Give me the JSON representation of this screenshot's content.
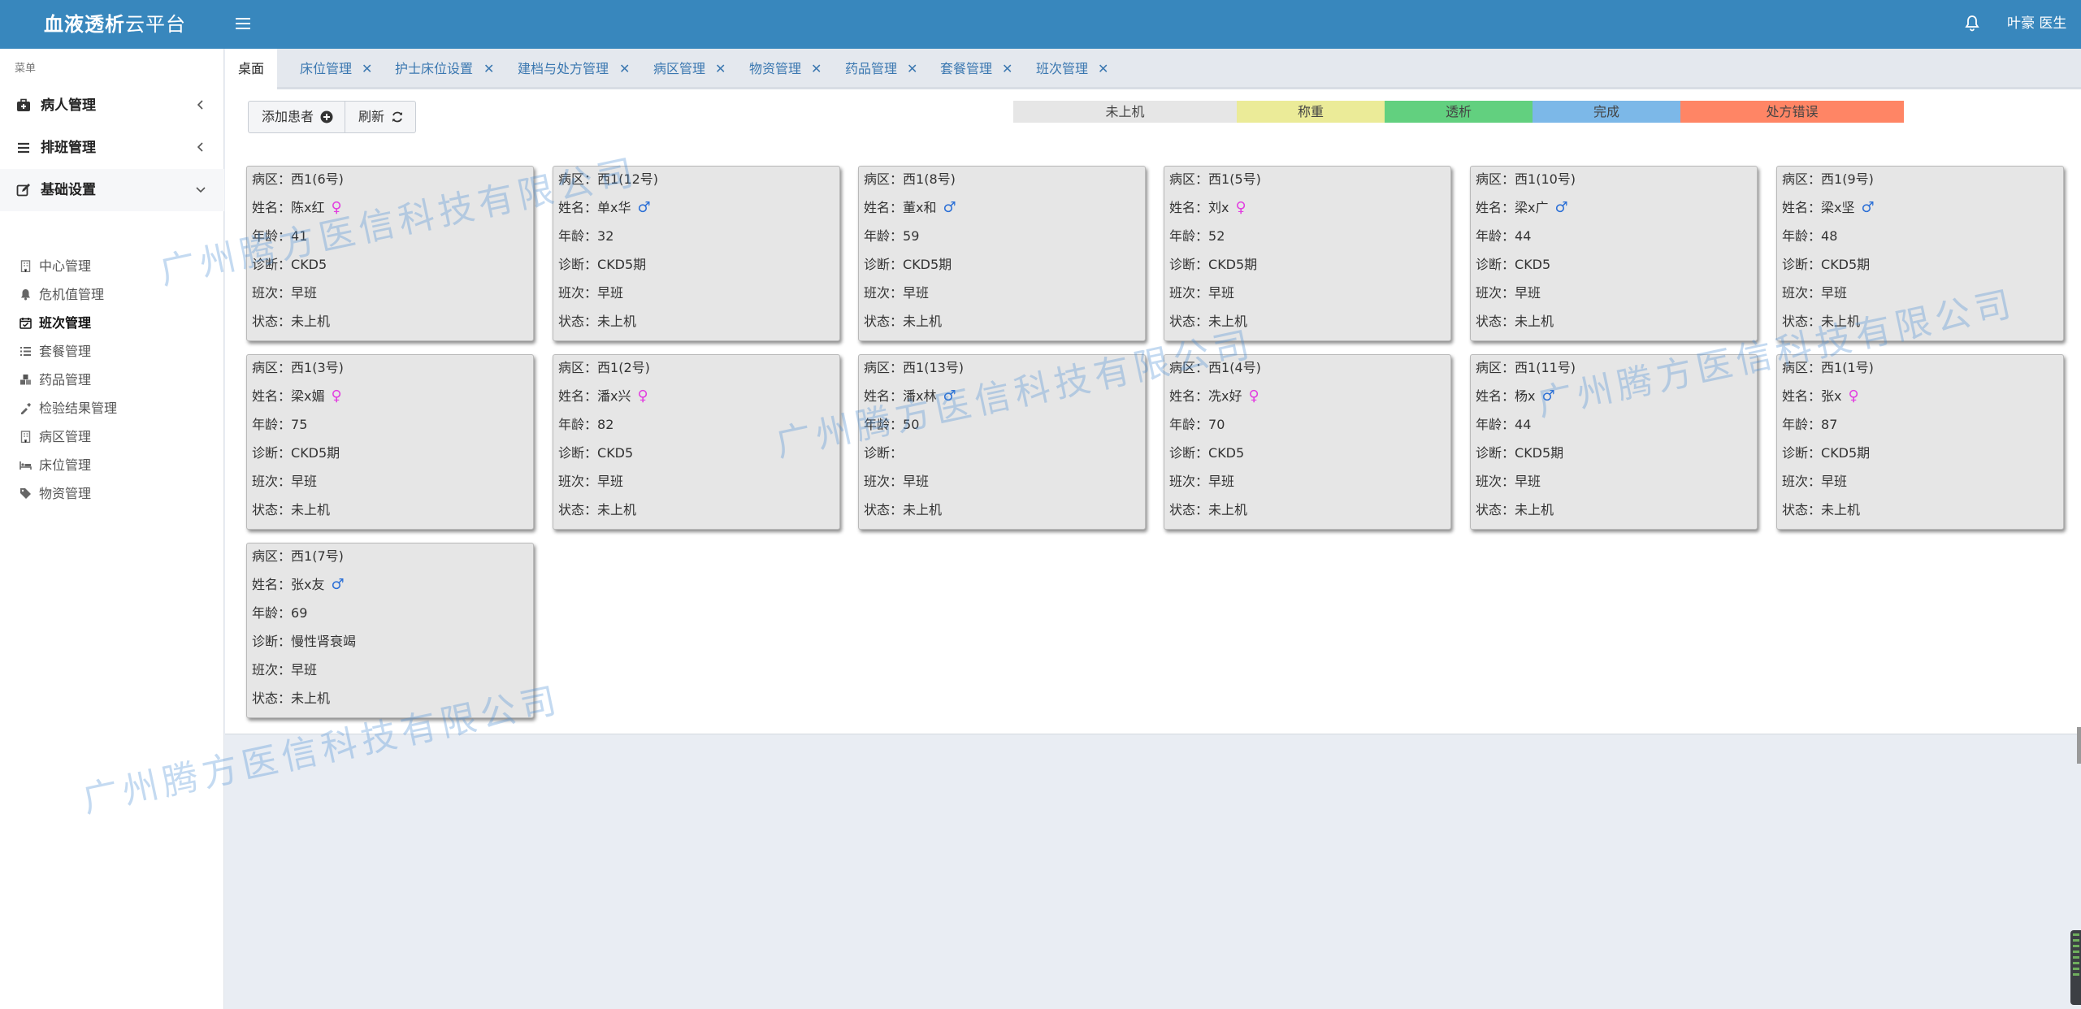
{
  "header": {
    "brand_bold": "血液透析",
    "brand_rest": "云平台",
    "user": "叶豪 医生"
  },
  "sidebar": {
    "caption": "菜单",
    "groups": [
      {
        "label": "病人管理",
        "icon": "medkit-icon",
        "expanded": false
      },
      {
        "label": "排班管理",
        "icon": "list-icon",
        "expanded": false
      },
      {
        "label": "基础设置",
        "icon": "edit-icon",
        "expanded": true
      }
    ],
    "items": [
      {
        "label": "中心管理",
        "icon": "building-icon"
      },
      {
        "label": "危机值管理",
        "icon": "bell-icon"
      },
      {
        "label": "班次管理",
        "icon": "calendar-check-icon"
      },
      {
        "label": "套餐管理",
        "icon": "list-icon"
      },
      {
        "label": "药品管理",
        "icon": "cubes-icon"
      },
      {
        "label": "检验结果管理",
        "icon": "eyedropper-icon"
      },
      {
        "label": "病区管理",
        "icon": "building-icon"
      },
      {
        "label": "床位管理",
        "icon": "bed-icon"
      },
      {
        "label": "物资管理",
        "icon": "tags-icon"
      }
    ],
    "current_item": "班次管理"
  },
  "tabs": [
    {
      "label": "桌面"
    },
    {
      "label": "床位管理"
    },
    {
      "label": "护士床位设置"
    },
    {
      "label": "建档与处方管理"
    },
    {
      "label": "病区管理"
    },
    {
      "label": "物资管理"
    },
    {
      "label": "药品管理"
    },
    {
      "label": "套餐管理"
    },
    {
      "label": "班次管理"
    }
  ],
  "toolbar": {
    "add_label": "添加患者",
    "refresh_label": "刷新"
  },
  "legend": [
    {
      "label": "未上机",
      "color": "#e6e6e6"
    },
    {
      "label": "称重",
      "color": "#ebeb98"
    },
    {
      "label": "透析",
      "color": "#62d07f"
    },
    {
      "label": "完成",
      "color": "#7cb8e8"
    },
    {
      "label": "处方错误",
      "color": "#ff8565"
    }
  ],
  "field_labels": {
    "ward": "病区：",
    "name": "姓名：",
    "age": "年龄：",
    "diagnosis": "诊断：",
    "shift": "班次：",
    "status": "状态："
  },
  "patients": [
    {
      "ward": "西1(6号)",
      "name": "陈x红",
      "sex": "female",
      "age": "41",
      "diagnosis": "CKD5",
      "shift": "早班",
      "status": "未上机"
    },
    {
      "ward": "西1(12号)",
      "name": "单x华",
      "sex": "male",
      "age": "32",
      "diagnosis": "CKD5期",
      "shift": "早班",
      "status": "未上机"
    },
    {
      "ward": "西1(8号)",
      "name": "董x和",
      "sex": "male",
      "age": "59",
      "diagnosis": "CKD5期",
      "shift": "早班",
      "status": "未上机"
    },
    {
      "ward": "西1(5号)",
      "name": "刘x",
      "sex": "female",
      "age": "52",
      "diagnosis": "CKD5期",
      "shift": "早班",
      "status": "未上机"
    },
    {
      "ward": "西1(10号)",
      "name": "梁x广",
      "sex": "male",
      "age": "44",
      "diagnosis": "CKD5",
      "shift": "早班",
      "status": "未上机"
    },
    {
      "ward": "西1(9号)",
      "name": "梁x坚",
      "sex": "male",
      "age": "48",
      "diagnosis": "CKD5期",
      "shift": "早班",
      "status": "未上机"
    },
    {
      "ward": "西1(3号)",
      "name": "梁x媚",
      "sex": "female",
      "age": "75",
      "diagnosis": "CKD5期",
      "shift": "早班",
      "status": "未上机"
    },
    {
      "ward": "西1(2号)",
      "name": "潘x兴",
      "sex": "female",
      "age": "82",
      "diagnosis": "CKD5",
      "shift": "早班",
      "status": "未上机"
    },
    {
      "ward": "西1(13号)",
      "name": "潘x林",
      "sex": "male",
      "age": "50",
      "diagnosis": "",
      "shift": "早班",
      "status": "未上机"
    },
    {
      "ward": "西1(4号)",
      "name": "冼x好",
      "sex": "female",
      "age": "70",
      "diagnosis": "CKD5",
      "shift": "早班",
      "status": "未上机"
    },
    {
      "ward": "西1(11号)",
      "name": "杨x",
      "sex": "male",
      "age": "44",
      "diagnosis": "CKD5期",
      "shift": "早班",
      "status": "未上机"
    },
    {
      "ward": "西1(1号)",
      "name": "张x",
      "sex": "female",
      "age": "87",
      "diagnosis": "CKD5期",
      "shift": "早班",
      "status": "未上机"
    },
    {
      "ward": "西1(7号)",
      "name": "张x友",
      "sex": "male",
      "age": "69",
      "diagnosis": "慢性肾衰竭",
      "shift": "早班",
      "status": "未上机"
    }
  ],
  "watermark": "广州腾方医信科技有限公司"
}
